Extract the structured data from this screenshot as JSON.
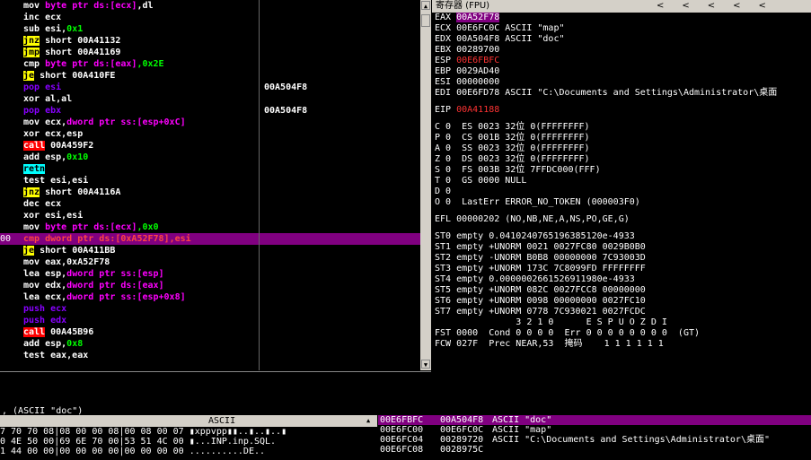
{
  "disasm": {
    "lines": [
      {
        "addr": "",
        "pre": "mov ",
        "kw": "byte ptr ds:[ecx]",
        "rest": ",dl",
        "cmt": ""
      },
      {
        "addr": "",
        "pre": "inc ecx",
        "kw": "",
        "rest": "",
        "cmt": ""
      },
      {
        "addr": "",
        "pre": "sub esi,",
        "kw": "",
        "rest": "0x1",
        "cmt": ""
      },
      {
        "addr": "",
        "pre": "jnz",
        "kw": "",
        "rest": " short 00A41132",
        "cmt": ""
      },
      {
        "addr": "",
        "pre": "jmp",
        "kw": "",
        "rest": " short 00A41169",
        "cmt": ""
      },
      {
        "addr": "",
        "pre": "cmp ",
        "kw": "byte ptr ds:[eax]",
        "rest": ",0x2E",
        "cmt": ""
      },
      {
        "addr": "",
        "pre": "je",
        "kw": "",
        "rest": " short 00A410FE",
        "cmt": ""
      },
      {
        "addr": "",
        "pre": "pop esi",
        "kw": "",
        "rest": "",
        "cmt": "00A504F8"
      },
      {
        "addr": "",
        "pre": "xor al,al",
        "kw": "",
        "rest": "",
        "cmt": ""
      },
      {
        "addr": "",
        "pre": "pop ebx",
        "kw": "",
        "rest": "",
        "cmt": "00A504F8"
      },
      {
        "addr": "",
        "pre": "mov ecx,",
        "kw": "dword ptr ss:[esp+0xC]",
        "rest": "",
        "cmt": ""
      },
      {
        "addr": "",
        "pre": "xor ecx,esp",
        "kw": "",
        "rest": "",
        "cmt": ""
      },
      {
        "addr": "",
        "pre": "call",
        "kw": "",
        "rest": " 00A459F2",
        "cmt": ""
      },
      {
        "addr": "",
        "pre": "add esp,",
        "kw": "",
        "rest": "0x10",
        "cmt": ""
      },
      {
        "addr": "",
        "pre": "retn",
        "kw": "",
        "rest": "",
        "cmt": ""
      },
      {
        "addr": "",
        "pre": "test esi,esi",
        "kw": "",
        "rest": "",
        "cmt": ""
      },
      {
        "addr": "",
        "pre": "jnz",
        "kw": "",
        "rest": " short 00A4116A",
        "cmt": ""
      },
      {
        "addr": "",
        "pre": "dec ecx",
        "kw": "",
        "rest": "",
        "cmt": ""
      },
      {
        "addr": "",
        "pre": "xor esi,esi",
        "kw": "",
        "rest": "",
        "cmt": ""
      },
      {
        "addr": "",
        "pre": "mov ",
        "kw": "byte ptr ds:[ecx]",
        "rest": ",0x0",
        "cmt": ""
      },
      {
        "addr": "00",
        "pre": "cmp ",
        "kw": "dword ptr ds:[0xA52F78]",
        "rest": ",esi",
        "cmt": ""
      },
      {
        "addr": "",
        "pre": "je",
        "kw": "",
        "rest": " short 00A411BB",
        "cmt": ""
      },
      {
        "addr": "",
        "pre": "mov eax,0xA52F78",
        "kw": "",
        "rest": "",
        "cmt": ""
      },
      {
        "addr": "",
        "pre": "lea esp,",
        "kw": "dword ptr ss:[esp]",
        "rest": "",
        "cmt": ""
      },
      {
        "addr": "",
        "pre": "mov edx,",
        "kw": "dword ptr ds:[eax]",
        "rest": "",
        "cmt": ""
      },
      {
        "addr": "",
        "pre": "lea ecx,",
        "kw": "dword ptr ss:[esp+0x8]",
        "rest": "",
        "cmt": ""
      },
      {
        "addr": "",
        "pre": "push ecx",
        "kw": "",
        "rest": "",
        "cmt": ""
      },
      {
        "addr": "",
        "pre": "push edx",
        "kw": "",
        "rest": "",
        "cmt": ""
      },
      {
        "addr": "",
        "pre": "call",
        "kw": "",
        "rest": " 00A45B96",
        "cmt": ""
      },
      {
        "addr": "",
        "pre": "add esp,",
        "kw": "",
        "rest": "0x8",
        "cmt": ""
      },
      {
        "addr": "",
        "pre": "test eax,eax",
        "kw": "",
        "rest": "",
        "cmt": ""
      }
    ]
  },
  "info": {
    "text": ", (ASCII \"doc\")"
  },
  "registers": {
    "title": "寄存器 (FPU)",
    "lines": [
      "EAX 00A52F78",
      "ECX 00E6FC0C ASCII \"map\"",
      "EDX 00A504F8 ASCII \"doc\"",
      "EBX 00289700",
      "ESP 00E6FBFC",
      "EBP 0029AD40",
      "ESI 00000000",
      "EDI 00E6FD78 ASCII \"C:\\Documents and Settings\\Administrator\\桌面",
      "",
      "EIP 00A41188",
      "",
      "C 0  ES 0023 32位 0(FFFFFFFF)",
      "P 0  CS 001B 32位 0(FFFFFFFF)",
      "A 0  SS 0023 32位 0(FFFFFFFF)",
      "Z 0  DS 0023 32位 0(FFFFFFFF)",
      "S 0  FS 003B 32位 7FFDC000(FFF)",
      "T 0  GS 0000 NULL",
      "D 0",
      "O 0  LastErr ERROR_NO_TOKEN (000003F0)",
      "",
      "EFL 00000202 (NO,NB,NE,A,NS,PO,GE,G)",
      "",
      "ST0 empty 0.0410240765196385120e-4933",
      "ST1 empty +UNORM 0021 0027FC80 0029B0B0",
      "ST2 empty -UNORM B0B8 00000000 7C93003D",
      "ST3 empty +UNORM 173C 7C8099FD FFFFFFFF",
      "ST4 empty 0.0000002661526911980e-4933",
      "ST5 empty +UNORM 082C 0027FCC8 00000000",
      "ST6 empty +UNORM 0098 00000000 0027FC10",
      "ST7 empty +UNORM 0778 7C930021 0027FCDC",
      "               3 2 1 0      E S P U O Z D I",
      "FST 0000  Cond 0 0 0 0  Err 0 0 0 0 0 0 0 0  (GT)",
      "FCW 027F  Prec NEAR,53  掩码    1 1 1 1 1 1"
    ]
  },
  "dump": {
    "header_ascii": "ASCII",
    "rows": [
      "7 70 70 08|08 00 00 08|00 08 00 07 ▮xppvpp▮▮..▮..▮..▮",
      "0 4E 50 00|69 6E 70 00|53 51 4C 00 ▮...INP.inp.SQL.",
      "1 44 00 00|00 00 00 00|00 00 00 00 ..........DE.."
    ]
  },
  "stack": {
    "rows": [
      {
        "addr": "00E6FBFC",
        "val": "00A504F8",
        "cmt": "ASCII \"doc\""
      },
      {
        "addr": "00E6FC00",
        "val": "00E6FC0C",
        "cmt": "ASCII \"map\""
      },
      {
        "addr": "00E6FC04",
        "val": "00289720",
        "cmt": "ASCII \"C:\\Documents and Settings\\Administrator\\桌面\""
      },
      {
        "addr": "00E6FC08",
        "val": "0028975C",
        "cmt": ""
      }
    ]
  }
}
